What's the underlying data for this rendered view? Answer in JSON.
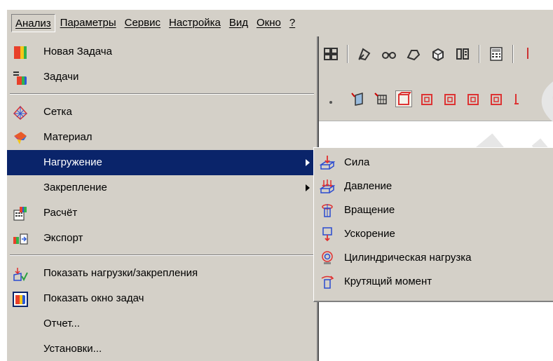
{
  "menubar": {
    "items": [
      {
        "label": "Анализ"
      },
      {
        "label": "Параметры"
      },
      {
        "label": "Сервис"
      },
      {
        "label": "Настройка"
      },
      {
        "label": "Вид"
      },
      {
        "label": "Окно"
      },
      {
        "label": "?"
      }
    ]
  },
  "analysis_menu": {
    "items": [
      {
        "label": "Новая Задача",
        "icon": "new-task-icon"
      },
      {
        "label": "Задачи",
        "icon": "tasks-icon"
      },
      {
        "label": "Сетка",
        "icon": "mesh-icon"
      },
      {
        "label": "Материал",
        "icon": "material-icon"
      },
      {
        "label": "Нагружение",
        "icon": "none",
        "submenu": true,
        "selected": true
      },
      {
        "label": "Закрепление",
        "icon": "none",
        "submenu": true
      },
      {
        "label": "Расчёт",
        "icon": "calculate-icon"
      },
      {
        "label": "Экспорт",
        "icon": "export-icon"
      },
      {
        "label": "Показать нагрузки/закрепления",
        "icon": "show-loads-icon"
      },
      {
        "label": "Показать окно задач",
        "icon": "show-tasks-window-icon"
      },
      {
        "label": "Отчет...",
        "icon": "none"
      },
      {
        "label": "Установки...",
        "icon": "none"
      }
    ]
  },
  "load_submenu": {
    "items": [
      {
        "label": "Сила",
        "icon": "force-icon"
      },
      {
        "label": "Давление",
        "icon": "pressure-icon"
      },
      {
        "label": "Вращение",
        "icon": "rotation-icon"
      },
      {
        "label": "Ускорение",
        "icon": "acceleration-icon"
      },
      {
        "label": "Цилиндрическая нагрузка",
        "icon": "cylindrical-load-icon"
      },
      {
        "label": "Крутящий момент",
        "icon": "torque-icon"
      }
    ]
  },
  "colors": {
    "menu_bg": "#d4d0c8",
    "highlight": "#0a246a",
    "highlight_text": "#ffffff"
  }
}
